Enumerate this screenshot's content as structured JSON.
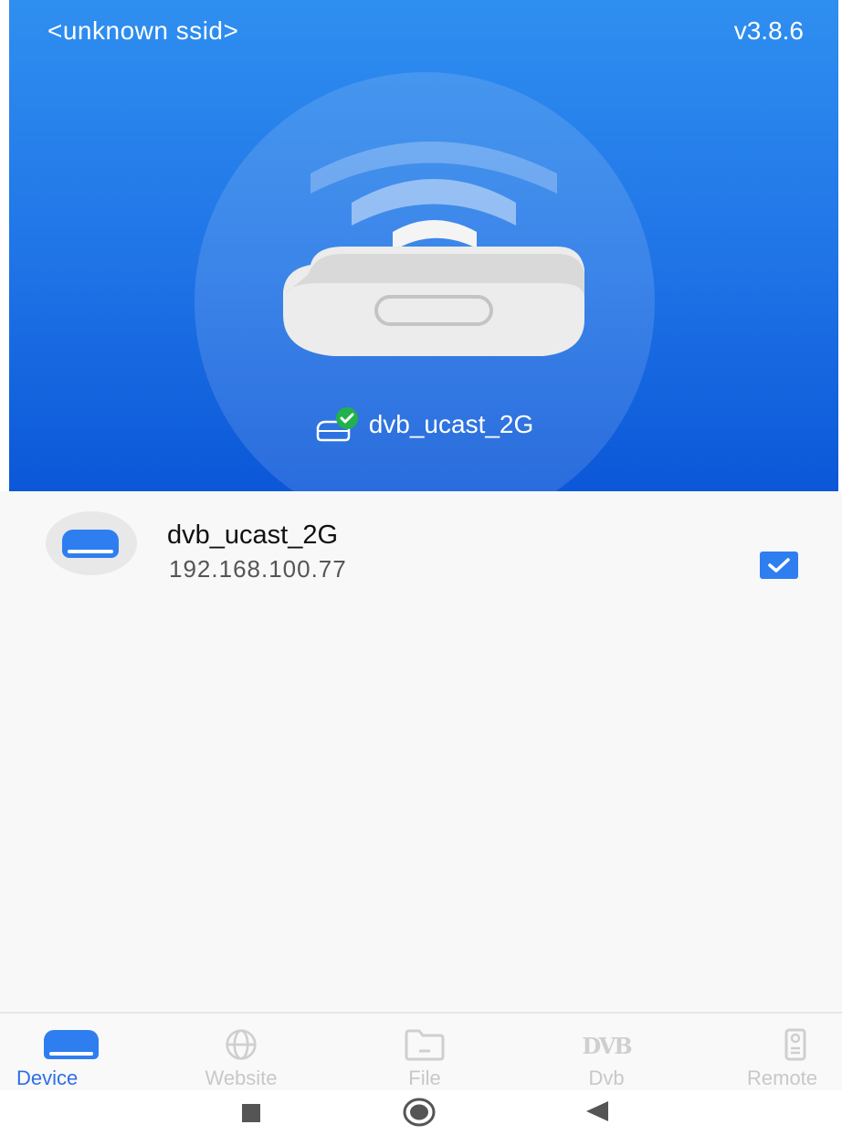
{
  "header": {
    "ssid": "<unknown ssid>",
    "version": "v3.8.6",
    "connected_device_name": "dvb_ucast_2G"
  },
  "devices": [
    {
      "name": "dvb_ucast_2G",
      "ip": "192.168.100.77",
      "selected": true
    }
  ],
  "bottom_nav": {
    "items": [
      {
        "label": "Device",
        "icon": "device-icon",
        "active": true
      },
      {
        "label": "Website",
        "icon": "globe-icon",
        "active": false
      },
      {
        "label": "File",
        "icon": "folder-icon",
        "active": false
      },
      {
        "label": "Dvb",
        "icon": "dvb-icon",
        "active": false
      },
      {
        "label": "Remote",
        "icon": "remote-icon",
        "active": false
      }
    ]
  },
  "system_nav": {
    "buttons": [
      "recent-apps-icon",
      "home-icon",
      "back-icon"
    ]
  },
  "colors": {
    "accent": "#2f7ef0",
    "header_top": "#2f8ff0",
    "header_bottom": "#0b57d8",
    "inactive_nav": "#c8c8c8",
    "check_green": "#22b14c"
  }
}
